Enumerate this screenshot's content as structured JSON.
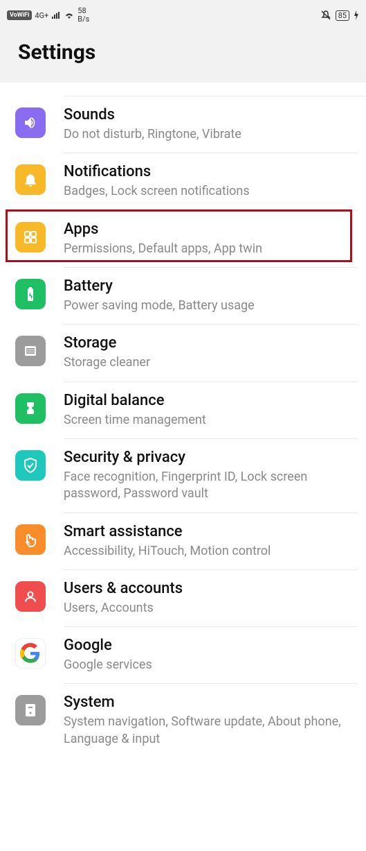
{
  "status": {
    "vowifi": "VoWiFi",
    "net": "4G+",
    "speed_top": "58",
    "speed_bot": "B/s",
    "battery": "85"
  },
  "page_title": "Settings",
  "items": [
    {
      "title": "Sounds",
      "sub": "Do not disturb, Ringtone, Vibrate"
    },
    {
      "title": "Notifications",
      "sub": "Badges, Lock screen notifications"
    },
    {
      "title": "Apps",
      "sub": "Permissions, Default apps, App twin"
    },
    {
      "title": "Battery",
      "sub": "Power saving mode, Battery usage"
    },
    {
      "title": "Storage",
      "sub": "Storage cleaner"
    },
    {
      "title": "Digital balance",
      "sub": "Screen time management"
    },
    {
      "title": "Security & privacy",
      "sub": "Face recognition, Fingerprint ID, Lock screen password, Password vault"
    },
    {
      "title": "Smart assistance",
      "sub": "Accessibility, HiTouch, Motion control"
    },
    {
      "title": "Users & accounts",
      "sub": "Users, Accounts"
    },
    {
      "title": "Google",
      "sub": "Google services"
    },
    {
      "title": "System",
      "sub": "System navigation, Software update, About phone, Language & input"
    }
  ]
}
